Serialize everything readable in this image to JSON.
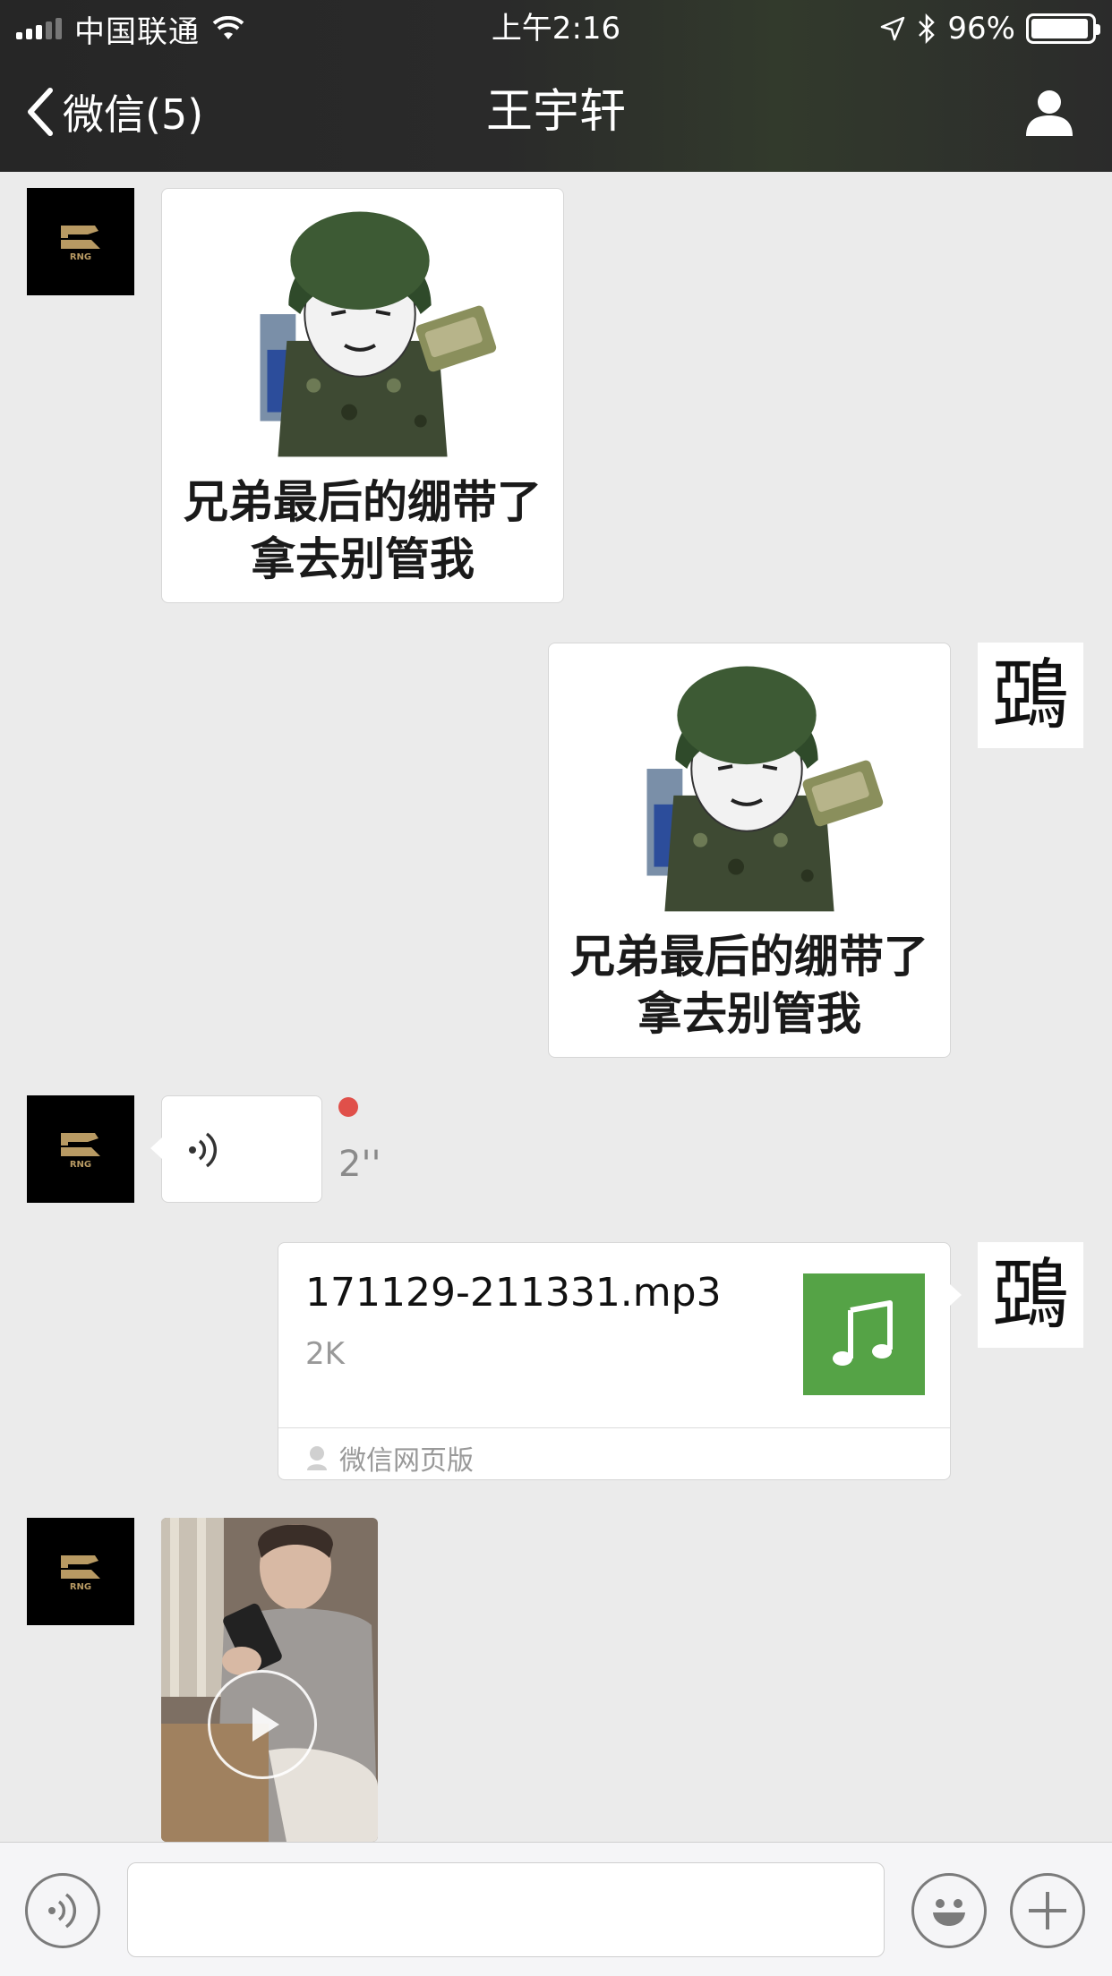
{
  "status_bar": {
    "carrier": "中国联通",
    "time": "上午2:16",
    "battery": "96%",
    "battery_level": 0.96
  },
  "nav": {
    "back_label": "微信(5)",
    "title": "王宇轩"
  },
  "contact_avatar": {
    "icon": "rng-logo"
  },
  "my_avatar": {
    "glyph": "鵶"
  },
  "messages": {
    "meme_1": {
      "caption_line1": "兄弟最后的绷带了",
      "caption_line2": "拿去别管我"
    },
    "meme_2": {
      "caption_line1": "兄弟最后的绷带了",
      "caption_line2": "拿去别管我"
    },
    "voice": {
      "duration": "2''",
      "unread_color": "#e0504a"
    },
    "file": {
      "name": "171129-211331.mp3",
      "size": "2K",
      "source": "微信网页版",
      "icon_color": "#55a346"
    },
    "video": {
      "icon": "play-icon"
    }
  },
  "input_bar": {
    "placeholder": ""
  }
}
